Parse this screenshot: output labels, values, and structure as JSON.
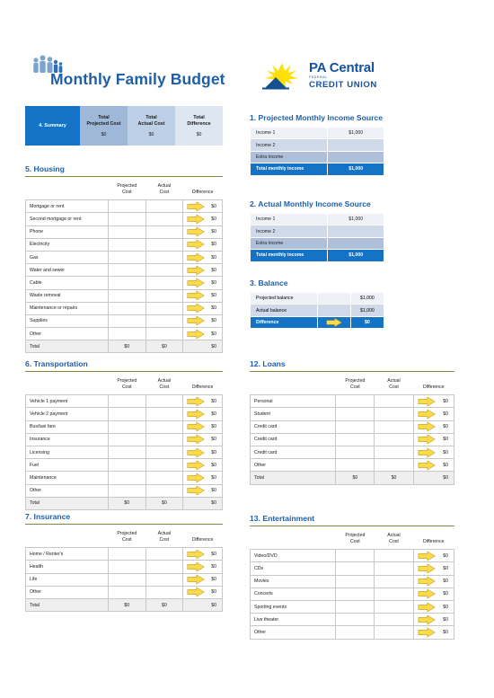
{
  "header": {
    "title": "Monthly Family Budget",
    "family_icon": "family-people-icon",
    "logo": {
      "mark": "sun-mountain-logo-icon",
      "line1": "PA Central",
      "sub": "FEDERAL",
      "line2": "CREDIT UNION"
    }
  },
  "summary": {
    "label": "4. Summary",
    "columns": [
      {
        "label": "Total\nProjected Cost",
        "label_line1": "Total",
        "label_line2": "Projected Cost",
        "value": "$0"
      },
      {
        "label": "Total\nActual Cost",
        "label_line1": "Total",
        "label_line2": "Actual Cost",
        "value": "$0"
      },
      {
        "label": "Total\nDifference",
        "label_line1": "Total",
        "label_line2": "Difference",
        "value": "$0"
      }
    ]
  },
  "projected_income": {
    "title": "1. Projected Monthly Income Source",
    "rows": [
      {
        "label": "Income 1",
        "value": "$1,000"
      },
      {
        "label": "Income 2",
        "value": ""
      },
      {
        "label": "Extra income",
        "value": ""
      }
    ],
    "total": {
      "label": "Total monthly income",
      "value": "$1,000"
    }
  },
  "actual_income": {
    "title": "2. Actual Monthly Income Source",
    "rows": [
      {
        "label": "Income 1",
        "value": "$1,000"
      },
      {
        "label": "Income 2",
        "value": ""
      },
      {
        "label": "Extra income",
        "value": ""
      }
    ],
    "total": {
      "label": "Total monthly income",
      "value": "$1,000"
    }
  },
  "balance": {
    "title": "3. Balance",
    "rows": [
      {
        "label": "Projected balance",
        "value": "$1,000"
      },
      {
        "label": "Actual balance",
        "value": "$1,000"
      }
    ],
    "difference": {
      "label": "Difference",
      "value": "$0",
      "arrow": "right-arrow-icon"
    }
  },
  "table_headers": {
    "projected_line1": "Projected",
    "projected_line2": "Cost",
    "actual_line1": "Actual",
    "actual_line2": "Cost",
    "difference": "Difference"
  },
  "housing": {
    "title": "5. Housing",
    "rows": [
      {
        "label": "Mortgage or rent",
        "projected": "",
        "actual": "",
        "difference": "$0"
      },
      {
        "label": "Second mortgage or rent",
        "projected": "",
        "actual": "",
        "difference": "$0"
      },
      {
        "label": "Phone",
        "projected": "",
        "actual": "",
        "difference": "$0"
      },
      {
        "label": "Electricity",
        "projected": "",
        "actual": "",
        "difference": "$0"
      },
      {
        "label": "Gas",
        "projected": "",
        "actual": "",
        "difference": "$0"
      },
      {
        "label": "Water and sewer",
        "projected": "",
        "actual": "",
        "difference": "$0"
      },
      {
        "label": "Cable",
        "projected": "",
        "actual": "",
        "difference": "$0"
      },
      {
        "label": "Waste removal",
        "projected": "",
        "actual": "",
        "difference": "$0"
      },
      {
        "label": "Maintenance or repairs",
        "projected": "",
        "actual": "",
        "difference": "$0"
      },
      {
        "label": "Supplies",
        "projected": "",
        "actual": "",
        "difference": "$0"
      },
      {
        "label": "Other",
        "projected": "",
        "actual": "",
        "difference": "$0"
      }
    ],
    "total": {
      "label": "Total",
      "projected": "$0",
      "actual": "$0",
      "difference": "$0"
    }
  },
  "transportation": {
    "title": "6. Transportation",
    "rows": [
      {
        "label": "Vehicle 1 payment",
        "projected": "",
        "actual": "",
        "difference": "$0"
      },
      {
        "label": "Vehicle 2 payment",
        "projected": "",
        "actual": "",
        "difference": "$0"
      },
      {
        "label": "Bus/taxi fare",
        "projected": "",
        "actual": "",
        "difference": "$0"
      },
      {
        "label": "Insurance",
        "projected": "",
        "actual": "",
        "difference": "$0"
      },
      {
        "label": "Licensing",
        "projected": "",
        "actual": "",
        "difference": "$0"
      },
      {
        "label": "Fuel",
        "projected": "",
        "actual": "",
        "difference": "$0"
      },
      {
        "label": "Maintenance",
        "projected": "",
        "actual": "",
        "difference": "$0"
      },
      {
        "label": "Other",
        "projected": "",
        "actual": "",
        "difference": "$0"
      }
    ],
    "total": {
      "label": "Total",
      "projected": "$0",
      "actual": "$0",
      "difference": "$0"
    }
  },
  "insurance": {
    "title": "7. Insurance",
    "rows": [
      {
        "label": "Home / Renter's",
        "projected": "",
        "actual": "",
        "difference": "$0"
      },
      {
        "label": "Health",
        "projected": "",
        "actual": "",
        "difference": "$0"
      },
      {
        "label": "Life",
        "projected": "",
        "actual": "",
        "difference": "$0"
      },
      {
        "label": "Other",
        "projected": "",
        "actual": "",
        "difference": "$0"
      }
    ],
    "total": {
      "label": "Total",
      "projected": "$0",
      "actual": "$0",
      "difference": "$0"
    }
  },
  "loans": {
    "title": "12. Loans",
    "rows": [
      {
        "label": "Personal",
        "projected": "",
        "actual": "",
        "difference": "$0"
      },
      {
        "label": "Student",
        "projected": "",
        "actual": "",
        "difference": "$0"
      },
      {
        "label": "Credit card",
        "projected": "",
        "actual": "",
        "difference": "$0"
      },
      {
        "label": "Credit card",
        "projected": "",
        "actual": "",
        "difference": "$0"
      },
      {
        "label": "Credit card",
        "projected": "",
        "actual": "",
        "difference": "$0"
      },
      {
        "label": "Other",
        "projected": "",
        "actual": "",
        "difference": "$0"
      }
    ],
    "total": {
      "label": "Total",
      "projected": "$0",
      "actual": "$0",
      "difference": "$0"
    }
  },
  "entertainment": {
    "title": "13. Entertainment",
    "rows": [
      {
        "label": "Video/DVD",
        "projected": "",
        "actual": "",
        "difference": "$0"
      },
      {
        "label": "CDs",
        "projected": "",
        "actual": "",
        "difference": "$0"
      },
      {
        "label": "Movies",
        "projected": "",
        "actual": "",
        "difference": "$0"
      },
      {
        "label": "Concerts",
        "projected": "",
        "actual": "",
        "difference": "$0"
      },
      {
        "label": "Sporting events",
        "projected": "",
        "actual": "",
        "difference": "$0"
      },
      {
        "label": "Live theater",
        "projected": "",
        "actual": "",
        "difference": "$0"
      },
      {
        "label": "Other",
        "projected": "",
        "actual": "",
        "difference": "$0"
      }
    ]
  },
  "colors": {
    "brand_blue": "#1f5fa8",
    "header_blue": "#1573c6",
    "arrow_yellow": "#f5d33a",
    "rule_olive": "#7a8b3f"
  }
}
